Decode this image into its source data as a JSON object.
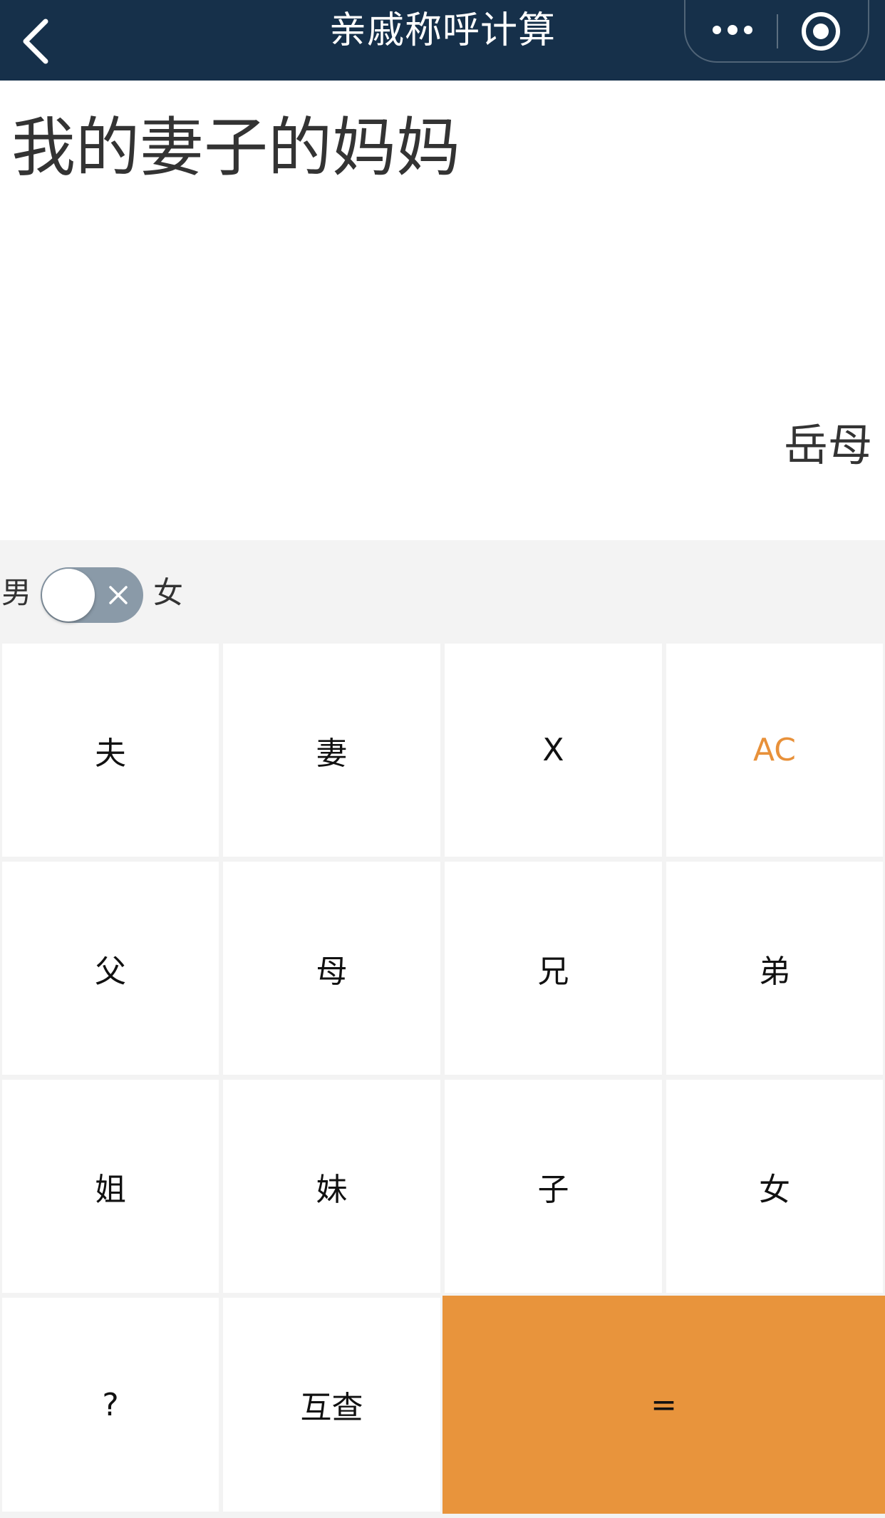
{
  "nav": {
    "title": "亲戚称呼计算",
    "back_icon": "chevron-left-icon",
    "more_icon": "more-dots-icon",
    "target_icon": "target-circle-icon",
    "background": "#16304a"
  },
  "display": {
    "expression": "我的妻子的妈妈",
    "result": "岳母"
  },
  "gender": {
    "male_label": "男",
    "female_label": "女",
    "toggle_on": false
  },
  "keys": {
    "row1": [
      "夫",
      "妻",
      "X",
      "AC"
    ],
    "row2": [
      "父",
      "母",
      "兄",
      "弟"
    ],
    "row3": [
      "姐",
      "妹",
      "子",
      "女"
    ],
    "row4": [
      "?",
      "互查",
      "="
    ]
  },
  "colors": {
    "accent": "#e8943c",
    "ac_text": "#e8913a"
  }
}
